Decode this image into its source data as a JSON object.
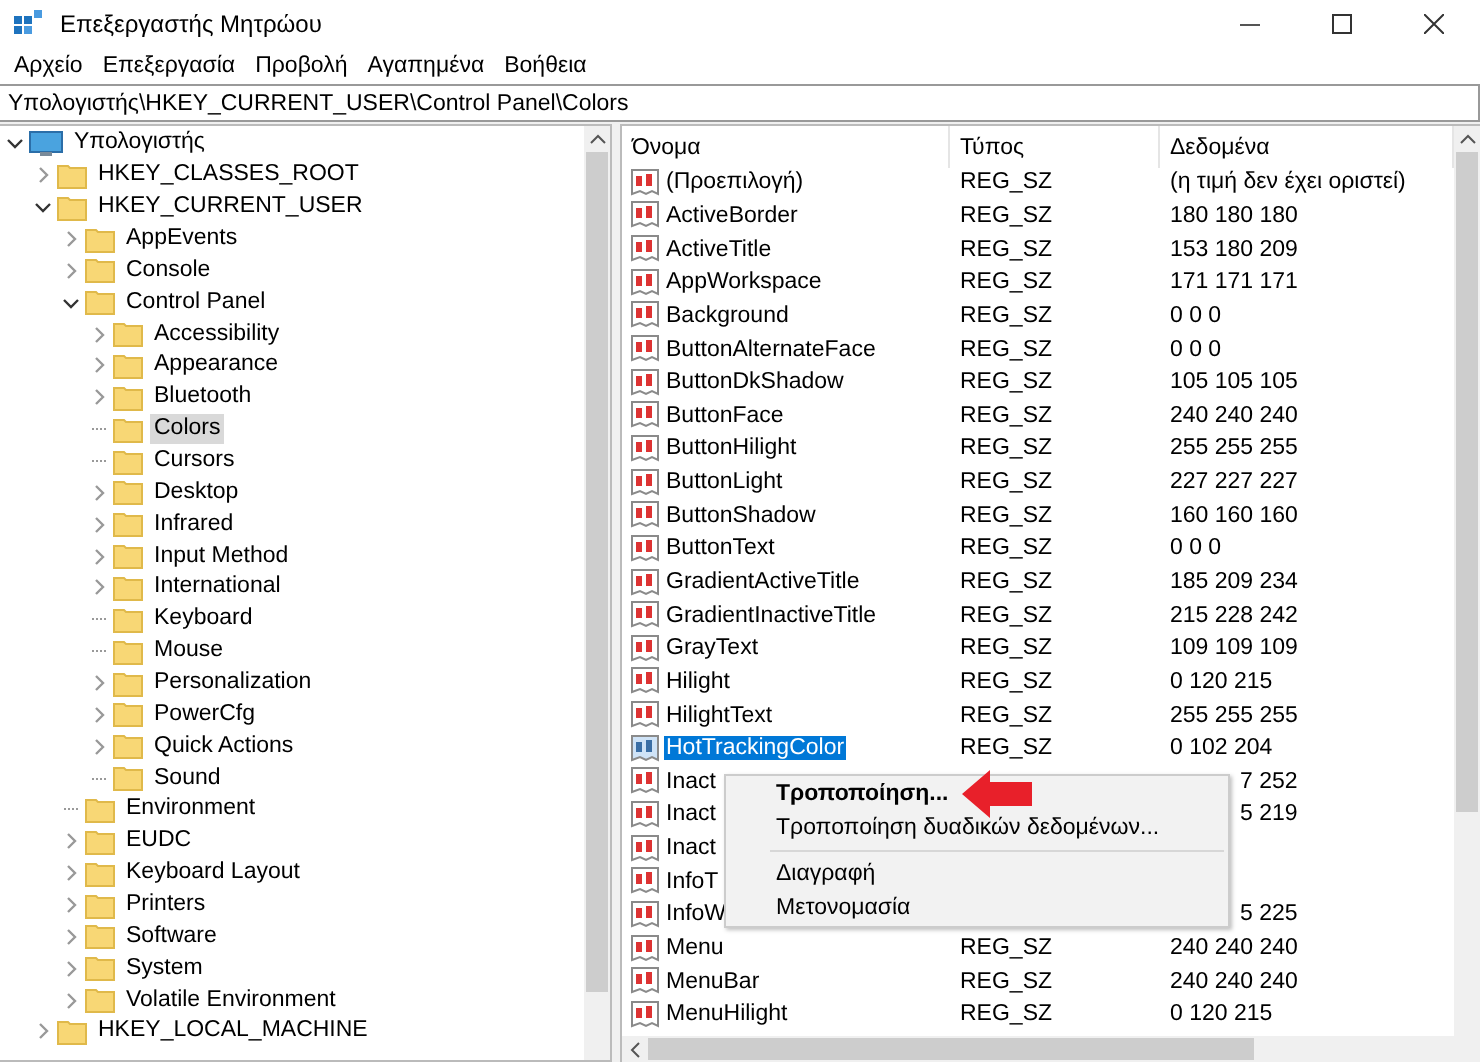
{
  "window": {
    "title": "Επεξεργαστής Μητρώου"
  },
  "menu_bar": [
    "Αρχείο",
    "Επεξεργασία",
    "Προβολή",
    "Αγαπημένα",
    "Βοήθεια"
  ],
  "address": "Υπολογιστής\\HKEY_CURRENT_USER\\Control Panel\\Colors",
  "tree": [
    {
      "label": "Υπολογιστής",
      "kind": "computer",
      "expanded": true,
      "selected": false,
      "children": [
        {
          "label": "HKEY_CLASSES_ROOT",
          "expanded": false,
          "selected": false
        },
        {
          "label": "HKEY_CURRENT_USER",
          "expanded": true,
          "selected": false,
          "children": [
            {
              "label": "AppEvents",
              "expanded": false,
              "selected": false
            },
            {
              "label": "Console",
              "expanded": false,
              "selected": false
            },
            {
              "label": "Control Panel",
              "expanded": true,
              "selected": false,
              "children": [
                {
                  "label": "Accessibility",
                  "expanded": false,
                  "selected": false
                },
                {
                  "label": "Appearance",
                  "expanded": false,
                  "selected": false
                },
                {
                  "label": "Bluetooth",
                  "expanded": false,
                  "selected": false
                },
                {
                  "label": "Colors",
                  "selected": true
                },
                {
                  "label": "Cursors",
                  "selected": false
                },
                {
                  "label": "Desktop",
                  "expanded": false,
                  "selected": false
                },
                {
                  "label": "Infrared",
                  "expanded": false,
                  "selected": false
                },
                {
                  "label": "Input Method",
                  "expanded": false,
                  "selected": false
                },
                {
                  "label": "International",
                  "expanded": false,
                  "selected": false
                },
                {
                  "label": "Keyboard",
                  "selected": false
                },
                {
                  "label": "Mouse",
                  "selected": false
                },
                {
                  "label": "Personalization",
                  "expanded": false,
                  "selected": false
                },
                {
                  "label": "PowerCfg",
                  "expanded": false,
                  "selected": false
                },
                {
                  "label": "Quick Actions",
                  "expanded": false,
                  "selected": false
                },
                {
                  "label": "Sound",
                  "selected": false
                }
              ]
            },
            {
              "label": "Environment",
              "selected": false
            },
            {
              "label": "EUDC",
              "expanded": false,
              "selected": false
            },
            {
              "label": "Keyboard Layout",
              "expanded": false,
              "selected": false
            },
            {
              "label": "Printers",
              "expanded": false,
              "selected": false
            },
            {
              "label": "Software",
              "expanded": false,
              "selected": false
            },
            {
              "label": "System",
              "expanded": false,
              "selected": false
            },
            {
              "label": "Volatile Environment",
              "expanded": false,
              "selected": false
            }
          ]
        },
        {
          "label": "HKEY_LOCAL_MACHINE",
          "expanded": false,
          "selected": false
        }
      ]
    }
  ],
  "table": {
    "columns": [
      "Όνομα",
      "Τύπος",
      "Δεδομένα"
    ],
    "rows": [
      {
        "kind": "full",
        "selected": false,
        "name": "(Προεπιλογή)",
        "type": "REG_SZ",
        "data": "(η τιμή δεν έχει οριστεί)"
      },
      {
        "kind": "full",
        "selected": false,
        "name": "ActiveBorder",
        "type": "REG_SZ",
        "data": "180 180 180"
      },
      {
        "kind": "full",
        "selected": false,
        "name": "ActiveTitle",
        "type": "REG_SZ",
        "data": "153 180 209"
      },
      {
        "kind": "full",
        "selected": false,
        "name": "AppWorkspace",
        "type": "REG_SZ",
        "data": "171 171 171"
      },
      {
        "kind": "full",
        "selected": false,
        "name": "Background",
        "type": "REG_SZ",
        "data": "0 0 0"
      },
      {
        "kind": "full",
        "selected": false,
        "name": "ButtonAlternateFace",
        "type": "REG_SZ",
        "data": "0 0 0"
      },
      {
        "kind": "full",
        "selected": false,
        "name": "ButtonDkShadow",
        "type": "REG_SZ",
        "data": "105 105 105"
      },
      {
        "kind": "full",
        "selected": false,
        "name": "ButtonFace",
        "type": "REG_SZ",
        "data": "240 240 240"
      },
      {
        "kind": "full",
        "selected": false,
        "name": "ButtonHilight",
        "type": "REG_SZ",
        "data": "255 255 255"
      },
      {
        "kind": "full",
        "selected": false,
        "name": "ButtonLight",
        "type": "REG_SZ",
        "data": "227 227 227"
      },
      {
        "kind": "full",
        "selected": false,
        "name": "ButtonShadow",
        "type": "REG_SZ",
        "data": "160 160 160"
      },
      {
        "kind": "full",
        "selected": false,
        "name": "ButtonText",
        "type": "REG_SZ",
        "data": "0 0 0"
      },
      {
        "kind": "full",
        "selected": false,
        "name": "GradientActiveTitle",
        "type": "REG_SZ",
        "data": "185 209 234"
      },
      {
        "kind": "full",
        "selected": false,
        "name": "GradientInactiveTitle",
        "type": "REG_SZ",
        "data": "215 228 242"
      },
      {
        "kind": "full",
        "selected": false,
        "name": "GrayText",
        "type": "REG_SZ",
        "data": "109 109 109"
      },
      {
        "kind": "full",
        "selected": false,
        "name": "Hilight",
        "type": "REG_SZ",
        "data": "0 120 215"
      },
      {
        "kind": "full",
        "selected": false,
        "name": "HilightText",
        "type": "REG_SZ",
        "data": "255 255 255"
      },
      {
        "kind": "full",
        "selected": true,
        "name": "HotTrackingColor",
        "type": "REG_SZ",
        "data": "0 102 204"
      },
      {
        "kind": "covered",
        "selected": false,
        "name": "Inact",
        "data": "7 252"
      },
      {
        "kind": "covered",
        "selected": false,
        "name": "Inact",
        "data": "5 219"
      },
      {
        "kind": "covered",
        "selected": false,
        "name": "Inact"
      },
      {
        "kind": "covered",
        "selected": false,
        "name": "InfoT"
      },
      {
        "kind": "covered",
        "selected": false,
        "name": "InfoW",
        "data": "5 225"
      },
      {
        "kind": "full",
        "selected": false,
        "name": "Menu",
        "type": "REG_SZ",
        "data": "240 240 240"
      },
      {
        "kind": "full",
        "selected": false,
        "name": "MenuBar",
        "type": "REG_SZ",
        "data": "240 240 240"
      },
      {
        "kind": "full",
        "selected": false,
        "name": "MenuHilight",
        "type": "REG_SZ",
        "data": "0 120 215"
      }
    ]
  },
  "context_menu": [
    {
      "kind": "item",
      "label": "Τροποποίηση...",
      "default": true
    },
    {
      "kind": "item",
      "label": "Τροποποίηση δυαδικών δεδομένων...",
      "default": false
    },
    {
      "kind": "separator"
    },
    {
      "kind": "item",
      "label": "Διαγραφή",
      "default": false
    },
    {
      "kind": "item",
      "label": "Μετονομασία",
      "default": false
    }
  ]
}
